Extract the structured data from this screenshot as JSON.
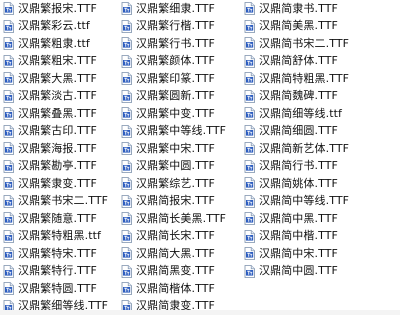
{
  "files": {
    "column_1": [
      "汉鼎繁报宋.TTF",
      "汉鼎繁彩云.ttf",
      "汉鼎繁粗隶.ttf",
      "汉鼎繁粗宋.TTF",
      "汉鼎繁大黑.TTF",
      "汉鼎繁淡古.TTF",
      "汉鼎繁叠黑.TTF",
      "汉鼎繁古印.TTF",
      "汉鼎繁海报.TTF",
      "汉鼎繁勘亭.TTF",
      "汉鼎繁隶变.TTF",
      "汉鼎繁书宋二.TTF",
      "汉鼎繁随意.TTF",
      "汉鼎繁特粗黑.ttf",
      "汉鼎繁特宋.TTF",
      "汉鼎繁特行.TTF",
      "汉鼎繁特圆.TTF",
      "汉鼎繁细等线.TTF"
    ],
    "column_2": [
      "汉鼎繁细隶.TTF",
      "汉鼎繁行楷.TTF",
      "汉鼎繁行书.TTF",
      "汉鼎繁颜体.TTF",
      "汉鼎繁印篆.TTF",
      "汉鼎繁圆新.TTF",
      "汉鼎繁中变.TTF",
      "汉鼎繁中等线.TTF",
      "汉鼎繁中宋.TTF",
      "汉鼎繁中圆.TTF",
      "汉鼎繁综艺.TTF",
      "汉鼎简报宋.TTF",
      "汉鼎简长美黑.TTF",
      "汉鼎简长宋.TTF",
      "汉鼎简大黑.TTF",
      "汉鼎简黑变.TTF",
      "汉鼎简楷体.TTF",
      "汉鼎简隶变.TTF"
    ],
    "column_3": [
      "汉鼎简隶书.TTF",
      "汉鼎简美黑.TTF",
      "汉鼎简书宋二.TTF",
      "汉鼎简舒体.TTF",
      "汉鼎简特粗黑.TTF",
      "汉鼎简魏碑.TTF",
      "汉鼎简细等线.ttf",
      "汉鼎简细圆.TTF",
      "汉鼎简新艺体.TTF",
      "汉鼎简行书.TTF",
      "汉鼎简姚体.TTF",
      "汉鼎简中等线.TTF",
      "汉鼎简中黑.TTF",
      "汉鼎简中楷.TTF",
      "汉鼎简中宋.TTF",
      "汉鼎简中圆.TTF"
    ]
  },
  "icon": {
    "name": "ttf-font-file-icon",
    "accent_color": "#2d5dbf",
    "paper_color": "#ffffff",
    "border_color": "#7a8faa"
  }
}
